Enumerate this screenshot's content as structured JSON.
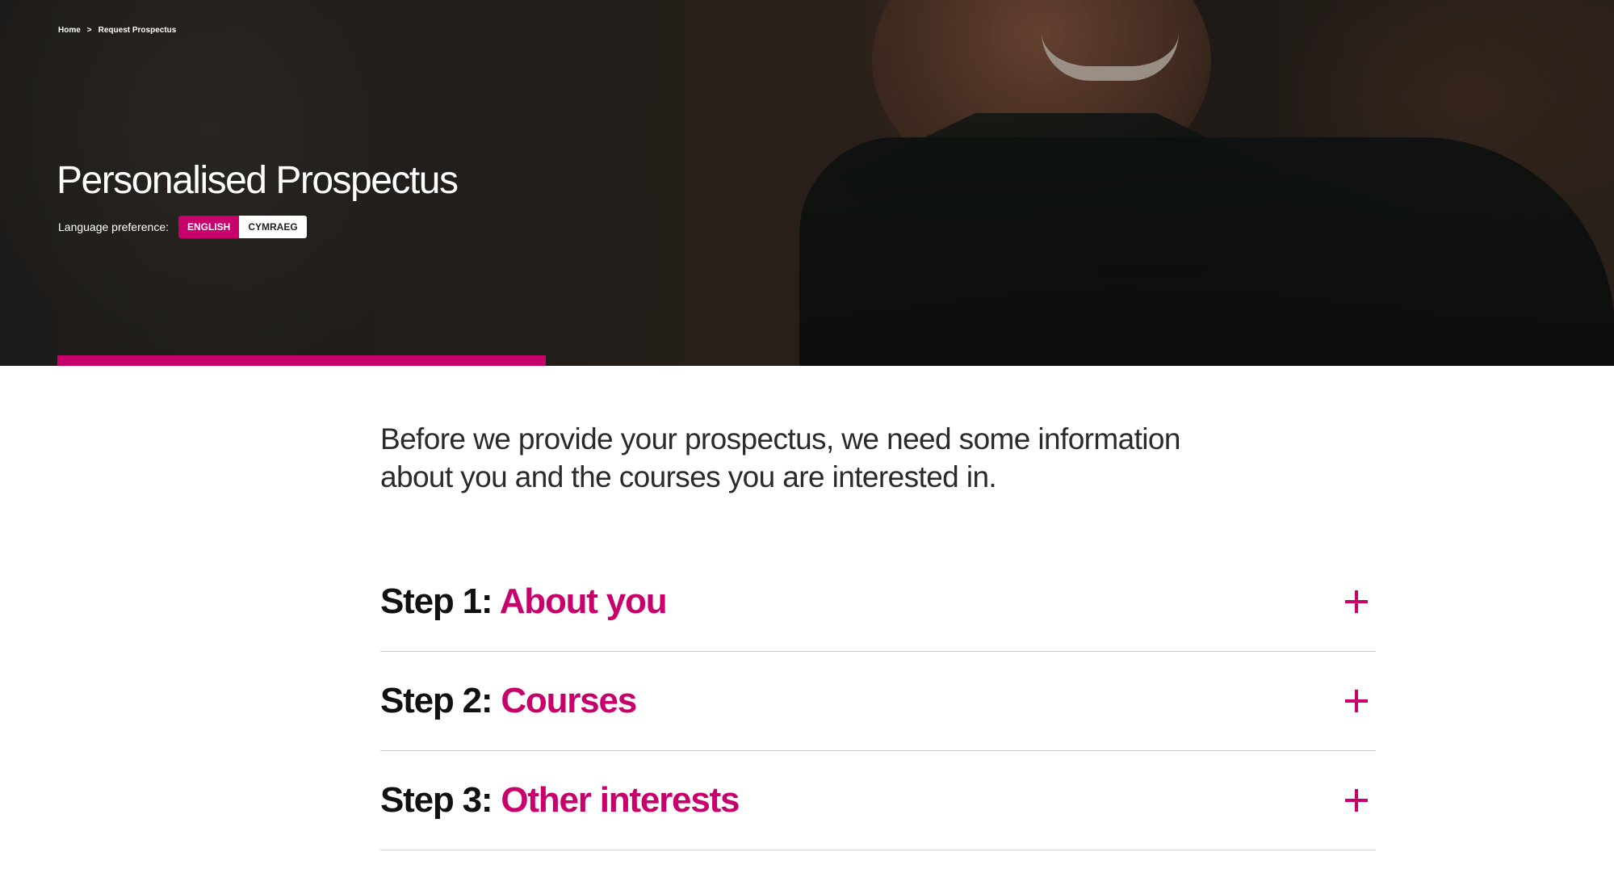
{
  "breadcrumb": {
    "home": "Home",
    "separator": ">",
    "current": "Request Prospectus"
  },
  "header": {
    "title": "Personalised Prospectus",
    "language_label": "Language preference:",
    "languages": [
      {
        "label": "ENGLISH",
        "active": true
      },
      {
        "label": "CYMRAEG",
        "active": false
      }
    ]
  },
  "progress": {
    "value": 0.3
  },
  "intro": {
    "text": "Before we provide your prospectus, we need some information about you and the courses you are interested in."
  },
  "steps": [
    {
      "prefix": "Step 1:",
      "name": "About you",
      "icon": "plus-icon"
    },
    {
      "prefix": "Step 2:",
      "name": "Courses",
      "icon": "plus-icon"
    },
    {
      "prefix": "Step 3:",
      "name": "Other interests",
      "icon": "plus-icon"
    }
  ],
  "colors": {
    "accent": "#c8006b",
    "text": "#111111",
    "divider": "#cfcfcf"
  }
}
